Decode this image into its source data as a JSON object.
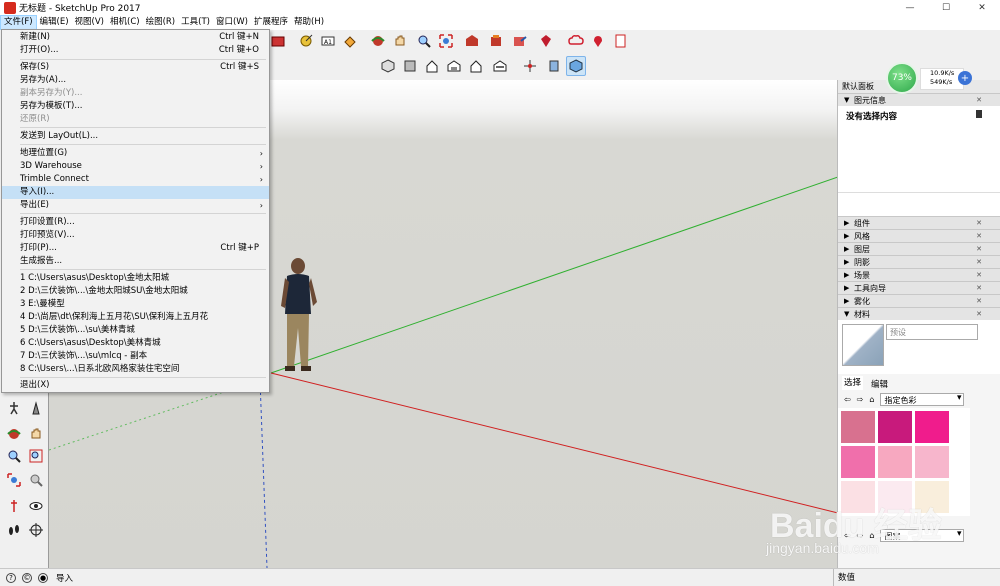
{
  "window": {
    "title": "无标题 - SketchUp Pro 2017",
    "minimize": "—",
    "maximize": "☐",
    "close": "✕"
  },
  "menubar": [
    "文件(F)",
    "编辑(E)",
    "视图(V)",
    "相机(C)",
    "绘图(R)",
    "工具(T)",
    "窗口(W)",
    "扩展程序",
    "帮助(H)"
  ],
  "file_menu": {
    "items": [
      {
        "label": "新建(N)",
        "shortcut": "Ctrl 键+N"
      },
      {
        "label": "打开(O)...",
        "shortcut": "Ctrl 键+O"
      },
      {
        "label": "保存(S)",
        "shortcut": "Ctrl 键+S"
      },
      {
        "label": "另存为(A)..."
      },
      {
        "label": "副本另存为(Y)..."
      },
      {
        "label": "另存为模板(T)..."
      },
      {
        "label": "还原(R)"
      },
      {
        "label": "发送到 LayOut(L)..."
      },
      {
        "label": "地理位置(G)"
      },
      {
        "label": "3D Warehouse"
      },
      {
        "label": "Trimble Connect"
      },
      {
        "label": "导入(I)..."
      },
      {
        "label": "导出(E)"
      },
      {
        "label": "打印设置(R)..."
      },
      {
        "label": "打印预览(V)..."
      },
      {
        "label": "打印(P)...",
        "shortcut": "Ctrl 键+P"
      },
      {
        "label": "生成报告..."
      },
      {
        "label": "1 C:\\Users\\asus\\Desktop\\金地太阳城"
      },
      {
        "label": "2 D:\\三伏装饰\\...\\金地太阳城SU\\金地太阳城"
      },
      {
        "label": "3 E:\\曼模型"
      },
      {
        "label": "4 D:\\尚层\\dt\\保利海上五月花\\SU\\保利海上五月花"
      },
      {
        "label": "5 D:\\三伏装饰\\...\\su\\美林青城"
      },
      {
        "label": "6 C:\\Users\\asus\\Desktop\\美林青城"
      },
      {
        "label": "7 D:\\三伏装饰\\...\\su\\mlcq - 副本"
      },
      {
        "label": "8 C:\\Users\\...\\日系北欧风格家装住宅空间"
      },
      {
        "label": "退出(X)"
      }
    ]
  },
  "tray": {
    "title": "默认面板",
    "entity_info": {
      "header": "图元信息",
      "body": "没有选择内容"
    },
    "panels": [
      "组件",
      "风格",
      "图层",
      "阴影",
      "场景",
      "工具向导",
      "雾化",
      "材料"
    ],
    "materials": {
      "name_placeholder": "预设",
      "tabs": [
        "选择",
        "编辑"
      ],
      "dropdown": "指定色彩",
      "swatches": [
        "#d8718f",
        "#c81a7c",
        "#f01c8c",
        "#f06fab",
        "#f7a8c0",
        "#f7b6cc",
        "#fbe0e4",
        "#fbeaf0",
        "#f9eedc"
      ],
      "secondary_dropdown": "图案"
    }
  },
  "net_widget": {
    "percent": "73%",
    "up": "10.9K/s",
    "down": "549K/s",
    "plus": "+"
  },
  "statusbar": {
    "text": "导入",
    "measure_label": "数值"
  },
  "watermark": {
    "brand": "Baidu 经验",
    "url": "jingyan.baidu.com"
  },
  "colors": {
    "menu_highlight": "#c5e0f6",
    "axis_red": "#d02020",
    "axis_green": "#30b030",
    "axis_blue": "#3050c0"
  }
}
